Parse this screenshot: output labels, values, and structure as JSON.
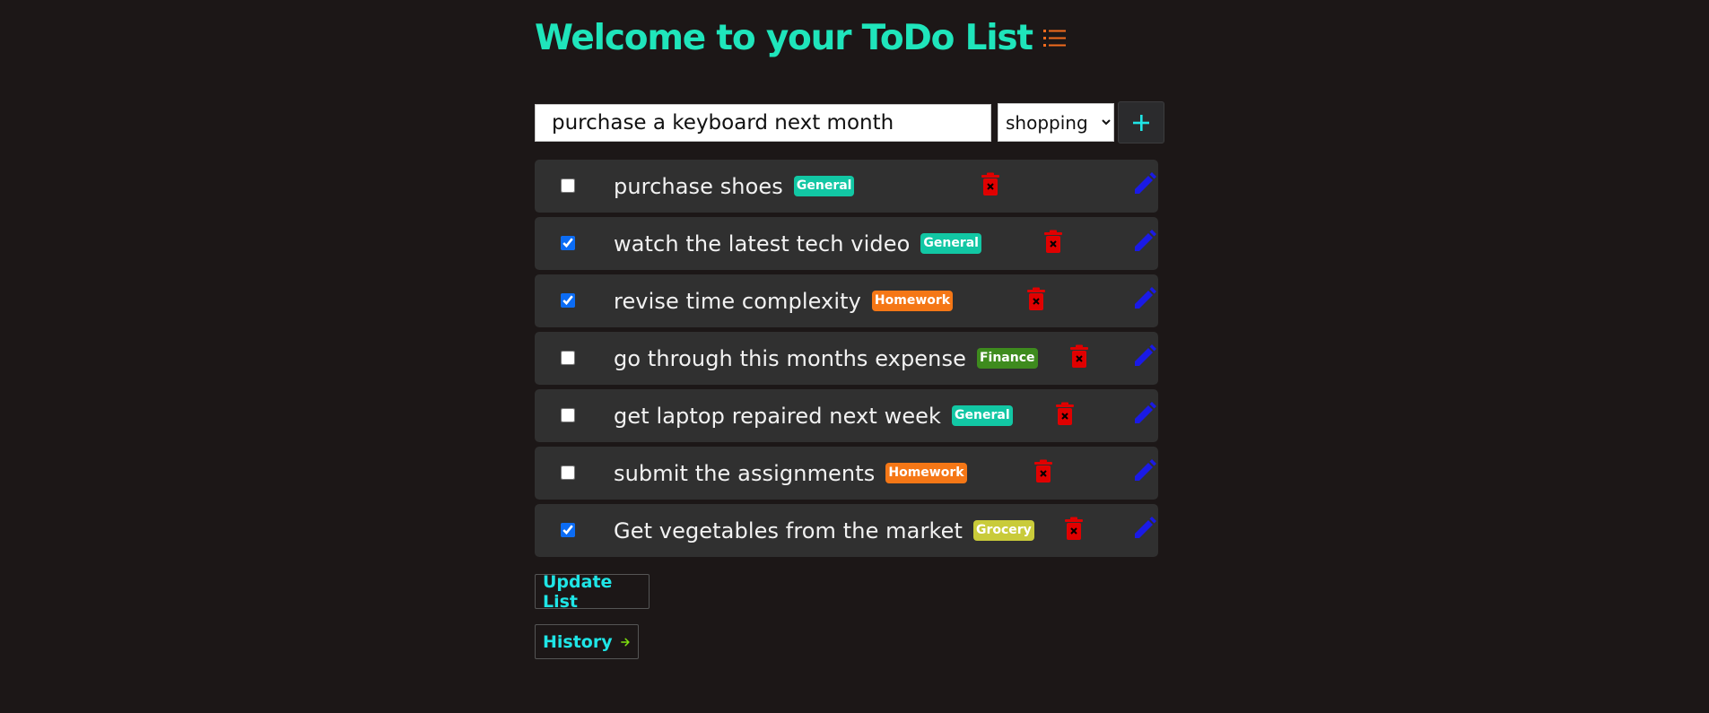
{
  "header": {
    "title": "Welcome to your ToDo List",
    "icon": "list-icon",
    "icon_color": "#f26b1d"
  },
  "new_task": {
    "value": "purchase a keyboard next month",
    "category_selected": "shopping",
    "add_icon": "plus-icon",
    "add_icon_color": "#1fe5e6"
  },
  "colors": {
    "title": "#1fe5bb",
    "background": "#1c1717",
    "item_background": "#303030",
    "delete": "#e00000",
    "edit": "#1a1ae6",
    "checkbox_checked": "#0b6cf4"
  },
  "tasks": [
    {
      "text": "purchase shoes",
      "tag": "General",
      "tag_color": "#12c7a4",
      "checked": false
    },
    {
      "text": "watch the latest tech video",
      "tag": "General",
      "tag_color": "#12c7a4",
      "checked": true
    },
    {
      "text": "revise time complexity",
      "tag": "Homework",
      "tag_color": "#f57716",
      "checked": true
    },
    {
      "text": "go through this months expense",
      "tag": "Finance",
      "tag_color": "#3e8b1e",
      "checked": false
    },
    {
      "text": "get laptop repaired next week",
      "tag": "General",
      "tag_color": "#12c7a4",
      "checked": false
    },
    {
      "text": "submit the assignments",
      "tag": "Homework",
      "tag_color": "#f57716",
      "checked": false
    },
    {
      "text": "Get vegetables from the market",
      "tag": "Grocery",
      "tag_color": "#c9cb3a",
      "checked": true
    }
  ],
  "actions": {
    "update_label": "Update List",
    "history_label": "History",
    "history_icon": "arrow-right-icon",
    "history_icon_color": "#7ee00f"
  }
}
